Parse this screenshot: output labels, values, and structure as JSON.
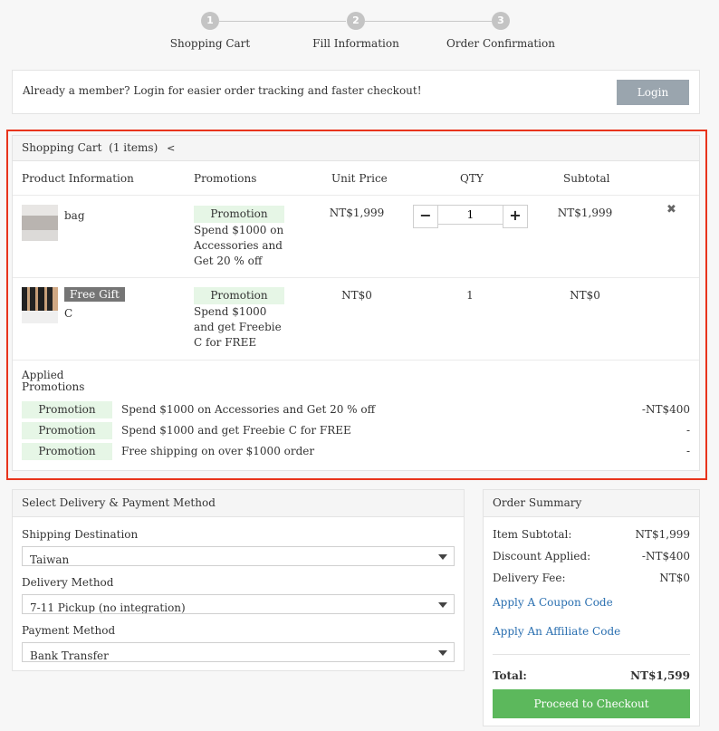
{
  "stepper": {
    "steps": [
      {
        "num": "1",
        "label": "Shopping Cart"
      },
      {
        "num": "2",
        "label": "Fill Information"
      },
      {
        "num": "3",
        "label": "Order Confirmation"
      }
    ]
  },
  "member": {
    "message": "Already a member? Login for easier order tracking and faster checkout!",
    "login_label": "Login"
  },
  "cart": {
    "title": "Shopping Cart",
    "count": "(1 items)",
    "share_icon": "share-icon",
    "columns": {
      "product": "Product Information",
      "promotions": "Promotions",
      "unit_price": "Unit Price",
      "qty": "QTY",
      "subtotal": "Subtotal"
    },
    "items": [
      {
        "name": "bag",
        "promo_tag": "Promotion",
        "promo_desc": "Spend $1000 on Accessories and Get 20 % off",
        "unit_price": "NT$1,999",
        "qty": "1",
        "subtotal": "NT$1,999",
        "minus": "−",
        "plus": "+",
        "remove": "✖"
      },
      {
        "badge": "Free Gift",
        "name": "C",
        "promo_tag": "Promotion",
        "promo_desc": "Spend $1000 and get Freebie C for FREE",
        "unit_price": "NT$0",
        "qty": "1",
        "subtotal": "NT$0"
      }
    ],
    "applied_label": "Applied Promotions",
    "applied": [
      {
        "tag": "Promotion",
        "desc": "Spend $1000 on Accessories and Get 20 % off",
        "amount": "-NT$400"
      },
      {
        "tag": "Promotion",
        "desc": "Spend $1000 and get Freebie C for FREE",
        "amount": "-"
      },
      {
        "tag": "Promotion",
        "desc": "Free shipping on over $1000 order",
        "amount": "-"
      }
    ]
  },
  "delivery": {
    "title": "Select Delivery & Payment Method",
    "shipping_label": "Shipping Destination",
    "shipping_value": "Taiwan",
    "method_label": "Delivery Method",
    "method_value": "7-11 Pickup (no integration)",
    "payment_label": "Payment Method",
    "payment_value": "Bank Transfer"
  },
  "summary": {
    "title": "Order Summary",
    "item_subtotal_label": "Item Subtotal:",
    "item_subtotal": "NT$1,999",
    "discount_label": "Discount Applied:",
    "discount": "-NT$400",
    "delivery_label": "Delivery Fee:",
    "delivery": "NT$0",
    "coupon_link": "Apply A Coupon Code",
    "affiliate_link": "Apply An Affiliate Code",
    "total_label": "Total:",
    "total": "NT$1,599",
    "checkout_label": "Proceed to Checkout"
  }
}
